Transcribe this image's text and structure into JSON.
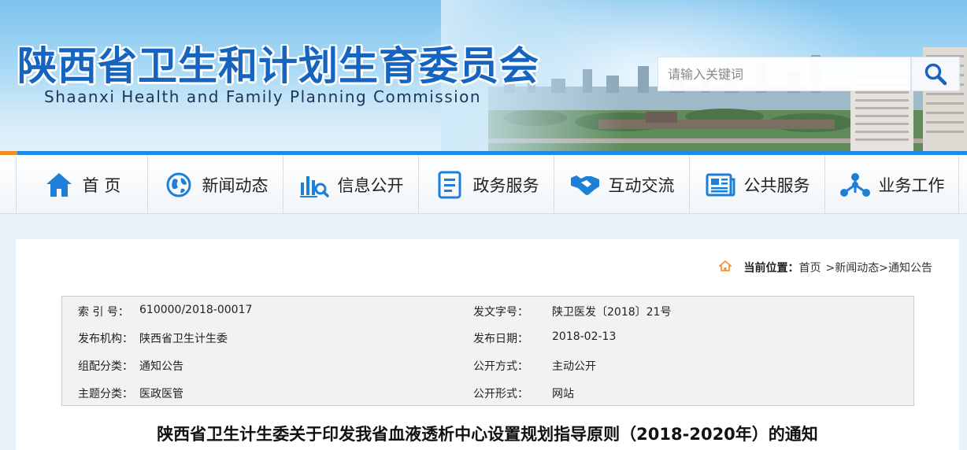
{
  "header": {
    "title": "陕西省卫生和计划生育委员会",
    "subtitle": "Shaanxi Health and Family Planning Commission"
  },
  "search": {
    "placeholder": "请输入关键词",
    "button_icon": "search-icon"
  },
  "nav": {
    "items": [
      {
        "label": "首 页",
        "icon": "home-icon"
      },
      {
        "label": "新闻动态",
        "icon": "globe-icon"
      },
      {
        "label": "信息公开",
        "icon": "chart-search-icon"
      },
      {
        "label": "政务服务",
        "icon": "document-icon"
      },
      {
        "label": "互动交流",
        "icon": "handshake-icon"
      },
      {
        "label": "公共服务",
        "icon": "news-icon"
      },
      {
        "label": "业务工作",
        "icon": "network-icon"
      }
    ]
  },
  "breadcrumb": {
    "prefix": "当前位置：",
    "items": [
      "首页",
      ">新闻动态",
      ">通知公告"
    ]
  },
  "meta": {
    "rows": [
      {
        "l1": "索 引 号：",
        "v1": "610000/2018-00017",
        "l2": "发文字号：",
        "v2": "陕卫医发〔2018〕21号"
      },
      {
        "l1": "发布机构：",
        "v1": "陕西省卫生计生委",
        "l2": "发布日期：",
        "v2": "2018-02-13"
      },
      {
        "l1": "组配分类：",
        "v1": "通知公告",
        "l2": "公开方式：",
        "v2": "主动公开"
      },
      {
        "l1": "主题分类：",
        "v1": "医政医管",
        "l2": "公开形式：",
        "v2": "网站"
      }
    ]
  },
  "article": {
    "title": "陕西省卫生计生委关于印发我省血液透析中心设置规划指导原则（2018-2020年）的通知"
  },
  "colors": {
    "brand_blue": "#1565c0",
    "nav_border": "#1e88e5",
    "accent_orange": "#f28c28",
    "icon_blue": "#1e7fd6"
  }
}
